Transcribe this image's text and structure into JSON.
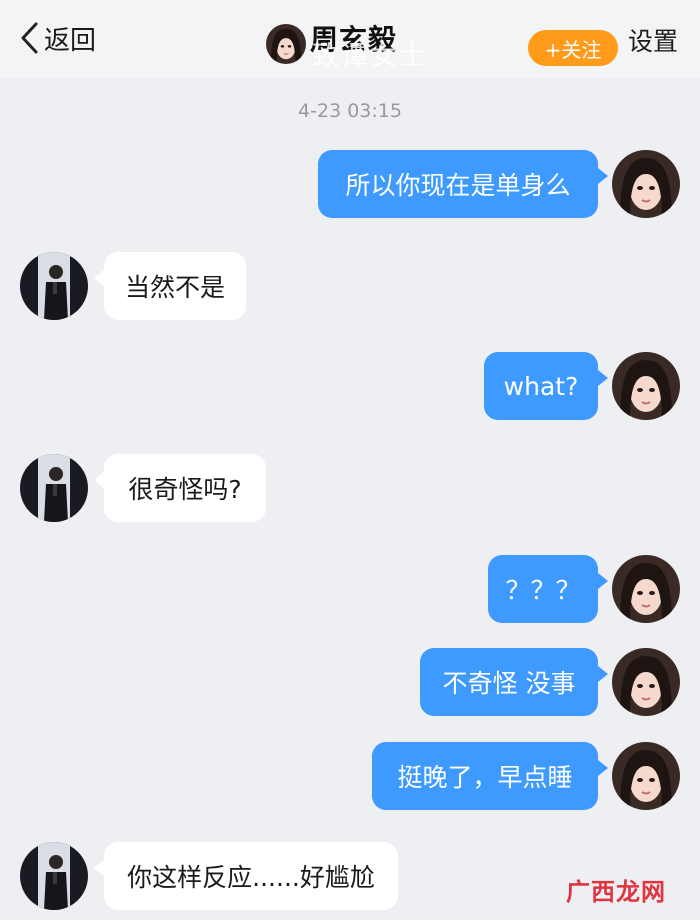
{
  "header": {
    "back_label": "返回",
    "title": "周玄毅",
    "overlay_watermark": "致谭女士",
    "follow_label": "+关注",
    "settings_label": "设置"
  },
  "timestamp": "4-23 03:15",
  "messages": [
    {
      "side": "sent",
      "text": "所以你现在是单身么"
    },
    {
      "side": "received",
      "text": "当然不是"
    },
    {
      "side": "sent",
      "text": "what?"
    },
    {
      "side": "received",
      "text": "很奇怪吗?"
    },
    {
      "side": "sent",
      "text": "？？？"
    },
    {
      "side": "sent",
      "text": "不奇怪 没事"
    },
    {
      "side": "sent",
      "text": "挺晚了，早点睡"
    },
    {
      "side": "received",
      "text": "你这样反应......好尴尬"
    }
  ],
  "corner_watermark": "广西龙网",
  "colors": {
    "sent_bubble": "#3e9aff",
    "received_bubble": "#ffffff",
    "follow_button": "#ff9a1a",
    "background": "#eeeff3"
  }
}
